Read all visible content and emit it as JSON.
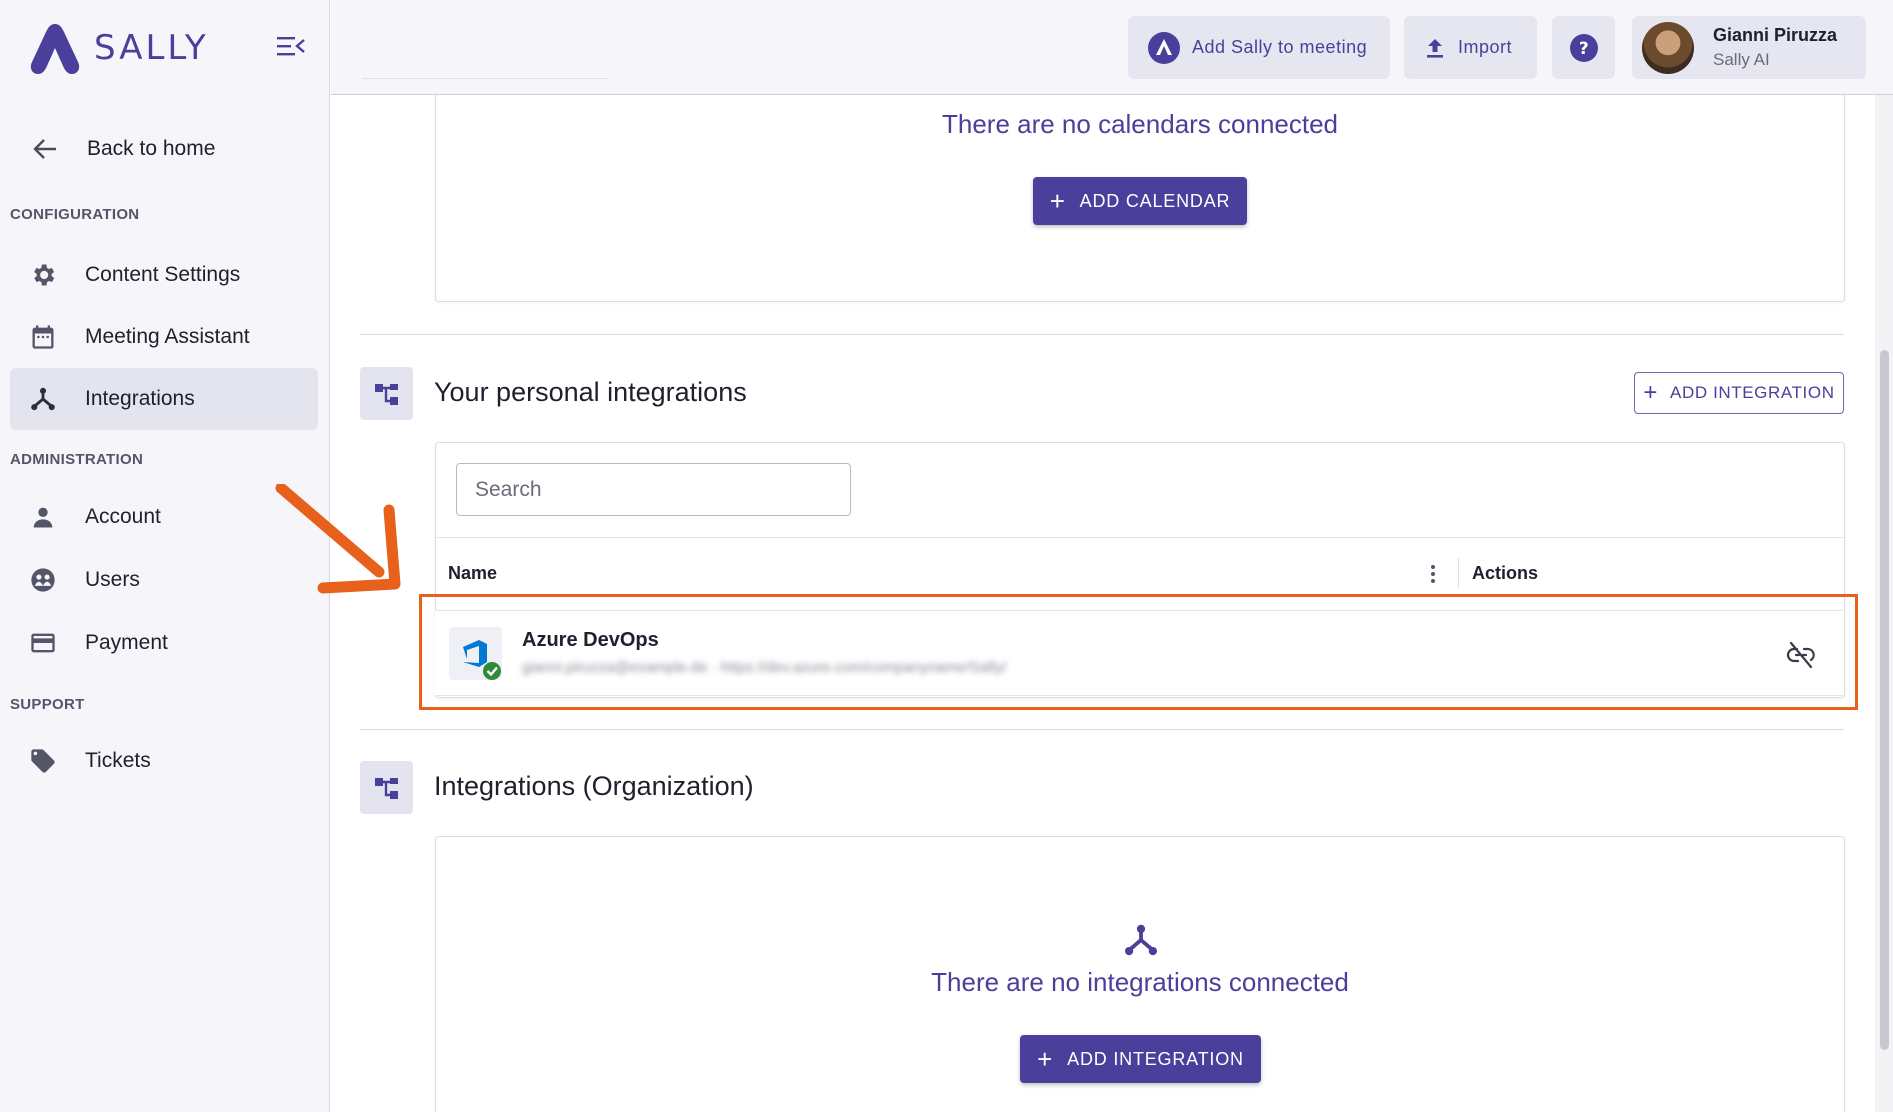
{
  "sidebar": {
    "brand": "SALLY",
    "back_label": "Back to home",
    "sections": {
      "configuration": "CONFIGURATION",
      "administration": "ADMINISTRATION",
      "support": "SUPPORT"
    },
    "items": {
      "content_settings": "Content Settings",
      "meeting_assistant": "Meeting Assistant",
      "integrations": "Integrations",
      "account": "Account",
      "users": "Users",
      "payment": "Payment",
      "tickets": "Tickets"
    },
    "active_item": "integrations"
  },
  "header": {
    "add_sally_label": "Add Sally to meeting",
    "import_label": "Import",
    "user": {
      "name": "Gianni Piruzza",
      "org": "Sally AI"
    }
  },
  "calendars": {
    "empty_text": "There are no calendars connected",
    "add_label": "ADD CALENDAR"
  },
  "personal_integrations": {
    "title": "Your personal integrations",
    "add_label": "ADD INTEGRATION",
    "search_placeholder": "Search",
    "columns": {
      "name": "Name",
      "actions": "Actions"
    },
    "rows": [
      {
        "title": "Azure DevOps",
        "subtitle": "gianni.piruzza@example.de · https://dev.azure.com/companyname/Sally/"
      }
    ]
  },
  "org_integrations": {
    "title": "Integrations (Organization)",
    "empty_text": "There are no integrations connected",
    "add_label": "ADD INTEGRATION"
  },
  "colors": {
    "brand": "#4a3f9a",
    "highlight": "#e8611c",
    "success": "#2e8b3a",
    "azure": "#0078d4"
  }
}
